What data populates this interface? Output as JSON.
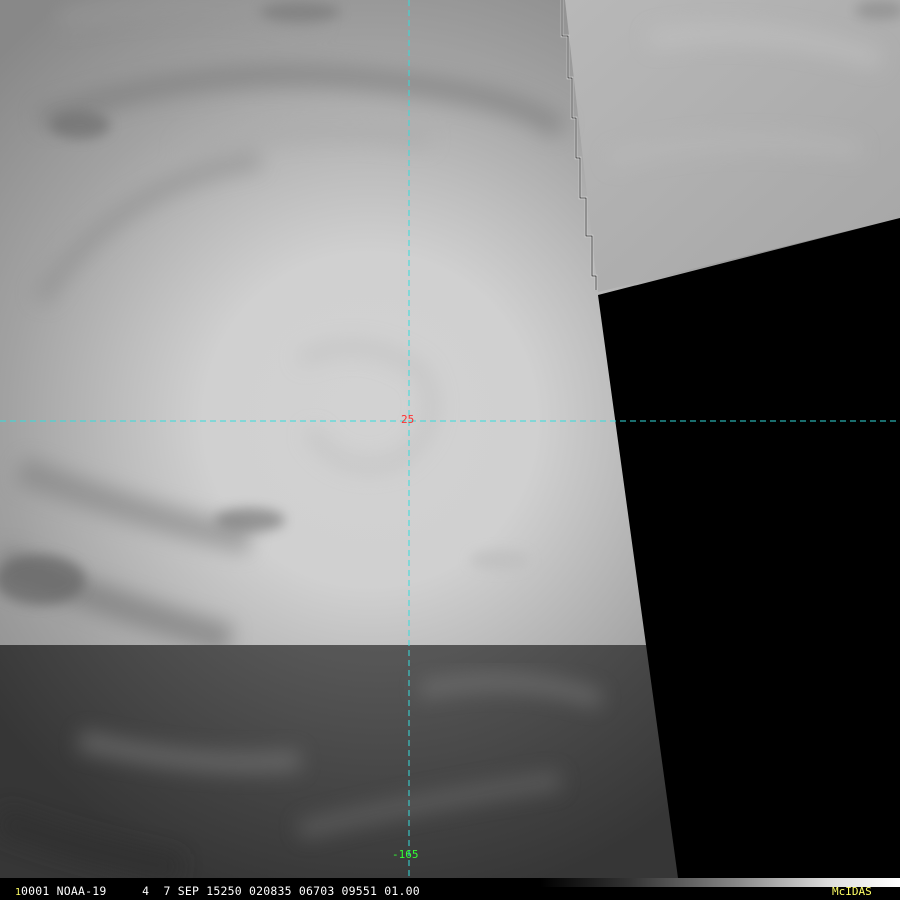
{
  "overlay": {
    "latitude_label": "25",
    "longitude_label": "-165"
  },
  "status_bar": {
    "frame_number": "1",
    "info_text": "0001 NOAA-19     4  7 SEP 15250 020835 06703 09551 01.00",
    "logo_text": "McIDAS"
  },
  "colors": {
    "grid_line": "#33dddd",
    "latitude_label": "#ff3030",
    "longitude_label": "#33ff33",
    "logo": "#ffff66",
    "no_data": "#000000",
    "coastline": "#d8d8d8"
  }
}
